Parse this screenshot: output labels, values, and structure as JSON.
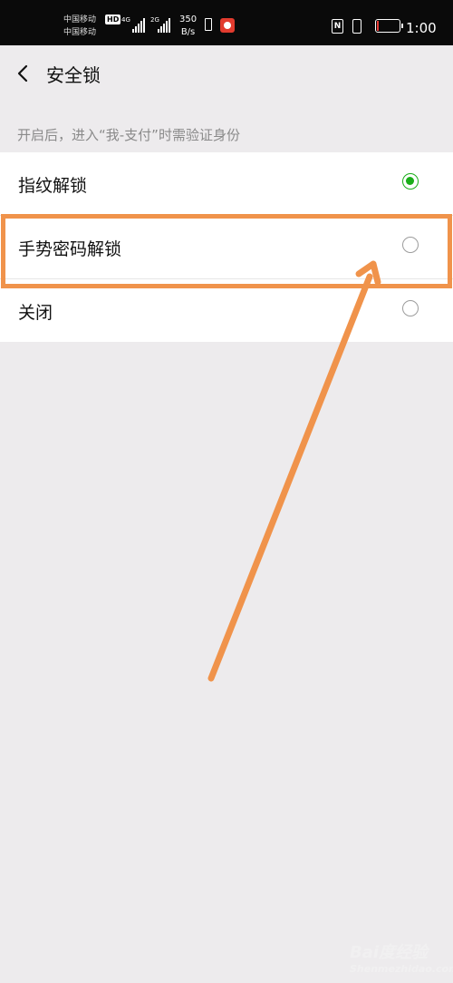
{
  "status_bar": {
    "carrier1": "中国移动",
    "carrier2": "中国移动",
    "hd": "HD",
    "net1": "4G",
    "net2": "2G",
    "speed_value": "350",
    "speed_unit": "B/s",
    "nfc": "N",
    "battery_level": 0.1,
    "time": "1:00"
  },
  "header": {
    "title": "安全锁"
  },
  "hint": "开启后，进入“我-支付”时需验证身份",
  "options": [
    {
      "label": "指纹解锁",
      "selected": true
    },
    {
      "label": "手势密码解锁",
      "selected": false
    },
    {
      "label": "关闭",
      "selected": false
    }
  ],
  "colors": {
    "accent": "#1aad19",
    "annotation": "#f0934b"
  },
  "watermark": {
    "brand": "Bai度经验",
    "domain": "Shenmezhidao.com"
  }
}
